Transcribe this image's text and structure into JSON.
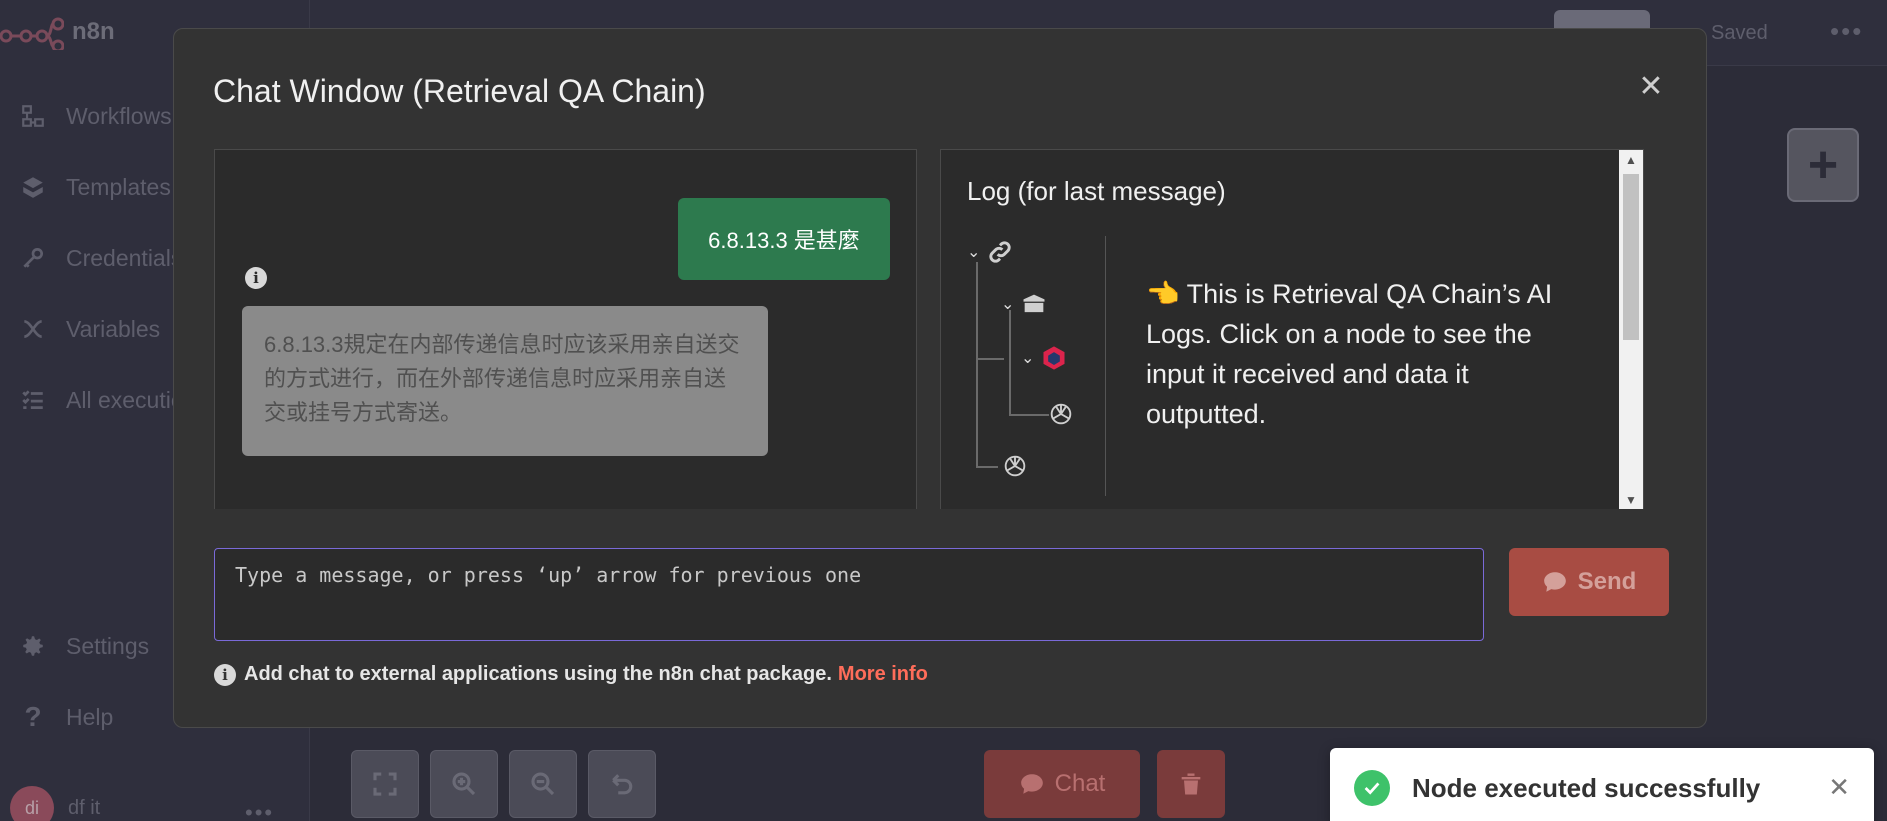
{
  "app": {
    "name": "n8n"
  },
  "sidebar": {
    "items": [
      {
        "label": "Workflows",
        "icon": "workflows-icon"
      },
      {
        "label": "Templates",
        "icon": "templates-icon"
      },
      {
        "label": "Credentials",
        "icon": "key-icon"
      },
      {
        "label": "Variables",
        "icon": "variables-icon"
      },
      {
        "label": "All executions",
        "icon": "list-icon"
      },
      {
        "label": "Settings",
        "icon": "gear-icon"
      },
      {
        "label": "Help",
        "icon": "question-icon"
      }
    ],
    "user": {
      "initials": "di",
      "name": "df it"
    }
  },
  "topbar": {
    "saved": "Saved"
  },
  "modal": {
    "title": "Chat Window (Retrieval QA Chain)",
    "messages": {
      "user": "6.8.13.3 是甚麼",
      "bot": "6.8.13.3規定在内部传递信息时应该采用亲自送交的方式进行，而在外部传递信息时应采用亲自送交或挂号方式寄送。"
    },
    "log": {
      "title": "Log (for last message)",
      "message": "👈 This is Retrieval QA Chain’s AI Logs. Click on a node to see the input it received and data it outputted."
    },
    "input": {
      "placeholder": "Type a message, or press ‘up’ arrow for previous one"
    },
    "send_label": "Send",
    "footer": {
      "text": "Add chat to external applications using the n8n chat package.",
      "link": "More info"
    }
  },
  "canvas": {
    "chat_label": "Chat"
  },
  "toast": {
    "message": "Node executed successfully"
  },
  "colors": {
    "accent": "#ff6d5a",
    "success": "#2d7a4e",
    "input_border": "#7a6ad8"
  }
}
